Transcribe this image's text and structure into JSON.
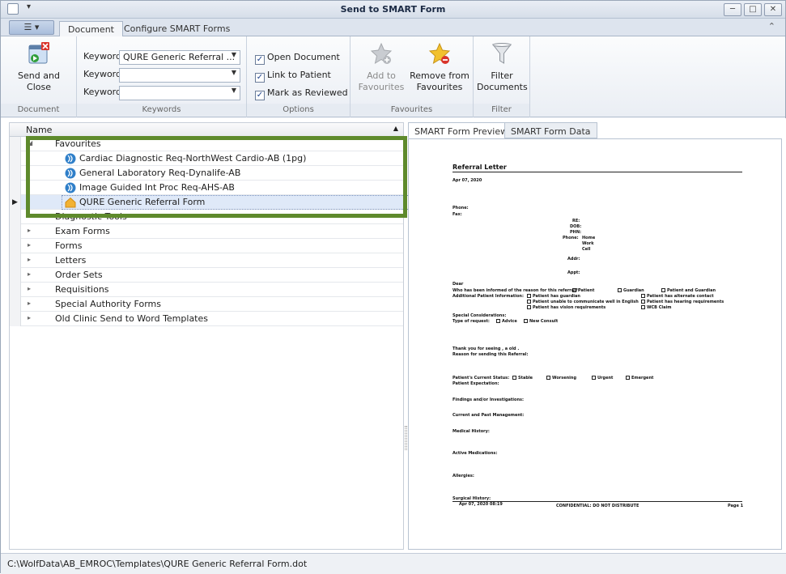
{
  "window": {
    "title": "Send to SMART Form"
  },
  "tabs": [
    {
      "label": "Document"
    },
    {
      "label": "Configure SMART Forms"
    }
  ],
  "ribbon": {
    "send_close": {
      "line1": "Send and",
      "line2": "Close"
    },
    "keywords": [
      {
        "label": "Keyword",
        "value": "QURE Generic Referral ..."
      },
      {
        "label": "Keyword",
        "value": ""
      },
      {
        "label": "Keyword",
        "value": ""
      }
    ],
    "options": [
      {
        "label": "Open Document",
        "checked": true
      },
      {
        "label": "Link to Patient",
        "checked": true
      },
      {
        "label": "Mark as Reviewed",
        "checked": true
      }
    ],
    "add_fav": {
      "line1": "Add to",
      "line2": "Favourites"
    },
    "remove_fav": {
      "line1": "Remove from",
      "line2": "Favourites"
    },
    "filter_docs": {
      "line1": "Filter",
      "line2": "Documents"
    },
    "groups": {
      "document": "Document",
      "keywords": "Keywords",
      "options": "Options",
      "favourites": "Favourites",
      "filter": "Filter"
    }
  },
  "tree": {
    "header": "Name",
    "favourites": {
      "label": "Favourites",
      "items": [
        "Cardiac Diagnostic Req-NorthWest Cardio-AB (1pg)",
        "General Laboratory Req-Dynalife-AB",
        "Image Guided Int Proc Req-AHS-AB",
        "QURE Generic Referral Form"
      ]
    },
    "categories": [
      "Diagnostic Tools",
      "Exam Forms",
      "Forms",
      "Letters",
      "Order Sets",
      "Requisitions",
      "Special Authority Forms",
      "Old Clinic Send to Word Templates"
    ]
  },
  "preview_tabs": [
    "SMART Form Preview",
    "SMART Form Data"
  ],
  "doc": {
    "title": "Referral Letter",
    "date": "Apr 07, 2020",
    "phone": "Phone:",
    "fax": "Fax:",
    "re": "RE:",
    "dob": "DOB:",
    "phn": "PHN:",
    "phone2": "Phone:",
    "home": "Home",
    "work": "Work",
    "cell": "Cell",
    "addr": "Addr:",
    "appt": "Appt:",
    "dear": "Dear",
    "informed": "Who has been informed of the reason for this referral?:",
    "patient": "Patient",
    "guardian": "Guardian",
    "patient_guardian": "Patient and Guardian",
    "additional": "Additional Patient Information:",
    "has_guardian": "Patient has guardian",
    "alt_contact": "Patient has alternate contact",
    "unable": "Patient unable to communicate well in English",
    "hearing": "Patient has hearing requirements",
    "vision": "Patient has vision requirements",
    "wcb": "WCB Claim",
    "special": "Special Considerations:",
    "type": "Type of request:",
    "advice": "Advice",
    "newconsult": "New Consult",
    "thanks": "Thank you for seeing , a old .",
    "reason": "Reason for sending this Referral:",
    "status": "Patient's Current Status:",
    "stable": "Stable",
    "worsening": "Worsening",
    "urgent": "Urgent",
    "emergent": "Emergent",
    "expectation": "Patient Expectation:",
    "findings": "Findings and/or Investigations:",
    "mgmt": "Current and Past Management:",
    "medical": "Medical History:",
    "meds": "Active Medications:",
    "allergies": "Allergies:",
    "surgical": "Surgical History:",
    "footer_date": "Apr 07, 2020 08:19",
    "confidential": "CONFIDENTIAL: DO NOT DISTRIBUTE",
    "page": "Page 1"
  },
  "status": {
    "path": "C:\\WolfData\\AB_EMROC\\Templates\\QURE Generic Referral Form.dot"
  }
}
